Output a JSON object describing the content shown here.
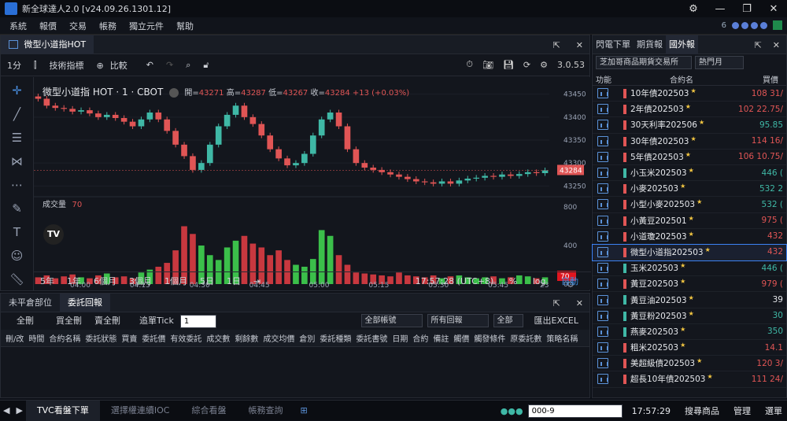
{
  "app": {
    "title": "新全球達人2.0 [v24.09.26.1301.12]"
  },
  "menu": [
    "系統",
    "報價",
    "交易",
    "帳務",
    "獨立元件",
    "幫助"
  ],
  "menu_right": {
    "count": "6"
  },
  "chart_panel": {
    "tab": "微型小道指HOT",
    "toolbar": {
      "interval": "1分",
      "indicators": "技術指標",
      "compare": "比較",
      "version": "3.0.53"
    },
    "symbol": "微型小道指 HOT · 1 · CBOT",
    "ohlc": {
      "open_label": "開",
      "open": "43271",
      "high_label": "高",
      "high": "43287",
      "low_label": "低",
      "low": "43267",
      "close_label": "收",
      "close": "43284",
      "change": "+13 (+0.03%)"
    },
    "price_ticks": [
      "43450",
      "43400",
      "43350",
      "43300",
      "43250"
    ],
    "last_price": "43284",
    "volume_label": "成交量",
    "volume_value": "70",
    "vol_ticks": [
      "800",
      "400",
      "0"
    ],
    "last_volume": "70",
    "time_ticks": [
      "04:00",
      "04:15",
      "04:30",
      "04:45",
      "05:00",
      "05:15",
      "05:30",
      "05:45",
      "23"
    ],
    "ranges": [
      "5年",
      "1年",
      "6個月",
      "3個月",
      "1個月",
      "5日",
      "1日"
    ],
    "clock": "17:57:28 (UTC+8)",
    "percent": "%",
    "log": "log",
    "auto": "自動"
  },
  "chart_data": {
    "type": "candlestick",
    "ylim": [
      43230,
      43470
    ],
    "x_start": "03:47",
    "x_end": "05:59",
    "price_path": [
      43440,
      43425,
      43420,
      43418,
      43412,
      43415,
      43408,
      43400,
      43405,
      43398,
      43390,
      43380,
      43395,
      43410,
      43395,
      43370,
      43340,
      43315,
      43285,
      43300,
      43340,
      43380,
      43405,
      43425,
      43400,
      43385,
      43360,
      43330,
      43310,
      43295,
      43300,
      43320,
      43360,
      43395,
      43410,
      43380,
      43330,
      43300,
      43290,
      43285,
      43280,
      43275,
      43270,
      43265,
      43260,
      43258,
      43255,
      43260,
      43255,
      43262,
      43266,
      43268,
      43272,
      43270,
      43275,
      43272,
      43276,
      43280,
      43278,
      43284
    ],
    "volume_path": [
      70,
      90,
      60,
      80,
      100,
      70,
      60,
      90,
      110,
      70,
      80,
      60,
      120,
      150,
      180,
      220,
      350,
      600,
      520,
      400,
      300,
      250,
      380,
      450,
      500,
      420,
      380,
      300,
      350,
      250,
      200,
      180,
      260,
      560,
      500,
      300,
      200,
      120,
      110,
      100,
      90,
      80,
      120,
      90,
      80,
      70,
      90,
      60,
      80,
      90,
      70,
      60,
      70,
      80,
      60,
      70,
      90,
      80,
      60,
      70
    ]
  },
  "right_panel": {
    "tabs": [
      "閃電下單",
      "期貨報",
      "國外報"
    ],
    "exchange": "芝加哥商品期貨交易所",
    "filter": "熱門月",
    "col_func": "功能",
    "col_name": "合約名",
    "col_price": "買價",
    "rows": [
      {
        "name": "10年債202503",
        "price": "108 31/",
        "color": "#e05555",
        "candle": "#e05555"
      },
      {
        "name": "2年債202503",
        "price": "102 22.75/",
        "color": "#e05555",
        "candle": "#e05555"
      },
      {
        "name": "30天利率202506",
        "price": "95.85",
        "color": "#3fb8a6",
        "candle": "#e05555"
      },
      {
        "name": "30年債202503",
        "price": "114 16/",
        "color": "#e05555",
        "candle": "#e05555"
      },
      {
        "name": "5年債202503",
        "price": "106 10.75/",
        "color": "#e05555",
        "candle": "#e05555"
      },
      {
        "name": "小玉米202503",
        "price": "446 (",
        "color": "#3fb8a6",
        "candle": "#3fb8a6"
      },
      {
        "name": "小麥202503",
        "price": "532 2",
        "color": "#3fb8a6",
        "candle": "#e05555"
      },
      {
        "name": "小型小麥202503",
        "price": "532 (",
        "color": "#3fb8a6",
        "candle": "#e05555"
      },
      {
        "name": "小黃豆202501",
        "price": "975 (",
        "color": "#e05555",
        "candle": "#e05555"
      },
      {
        "name": "小道瓊202503",
        "price": "432",
        "color": "#e05555",
        "candle": "#e05555"
      },
      {
        "name": "微型小道指202503",
        "price": "432",
        "color": "#e05555",
        "candle": "#e05555",
        "selected": true
      },
      {
        "name": "玉米202503",
        "price": "446 (",
        "color": "#3fb8a6",
        "candle": "#3fb8a6"
      },
      {
        "name": "黃豆202503",
        "price": "979 (",
        "color": "#e05555",
        "candle": "#e05555"
      },
      {
        "name": "黃豆油202503",
        "price": "39",
        "color": "#e6e8ec",
        "candle": "#3fb8a6"
      },
      {
        "name": "黃豆粉202503",
        "price": "30",
        "color": "#3fb8a6",
        "candle": "#3fb8a6"
      },
      {
        "name": "燕麥202503",
        "price": "350 ",
        "color": "#3fb8a6",
        "candle": "#3fb8a6"
      },
      {
        "name": "粗米202503",
        "price": "14.1",
        "color": "#e05555",
        "candle": "#e05555"
      },
      {
        "name": "美超級債202503",
        "price": "120 3/",
        "color": "#e05555",
        "candle": "#e05555"
      },
      {
        "name": "超長10年債202503",
        "price": "111 24/",
        "color": "#e05555",
        "candle": "#e05555"
      }
    ]
  },
  "order_panel": {
    "tabs": [
      "未平倉部位",
      "委託回報"
    ],
    "buttons": {
      "cancel_all": "全刪",
      "cancel_buy": "買全刪",
      "cancel_sell": "賣全刪",
      "chase": "追單Tick",
      "chase_val": "1",
      "export": "匯出EXCEL"
    },
    "selects": {
      "account": "全部帳號",
      "report": "所有回報",
      "all": "全部"
    },
    "columns": [
      "刪/改",
      "時間",
      "合約名稱",
      "委託狀態",
      "買賣",
      "委託價",
      "有效委託",
      "成交數",
      "剩餘數",
      "成交均價",
      "倉別",
      "委託種類",
      "委託書號",
      "日期",
      "合約",
      "備註",
      "觸價",
      "觸發條件",
      "原委託數",
      "策略名稱"
    ]
  },
  "bottom": {
    "tabs": [
      "TVC看盤下單",
      "選擇權連續IOC",
      "綜合看盤",
      "帳務查詢"
    ],
    "account": "000-9",
    "time": "17:57:29",
    "search": "搜尋商品",
    "manage": "管理",
    "menu": "選單"
  }
}
